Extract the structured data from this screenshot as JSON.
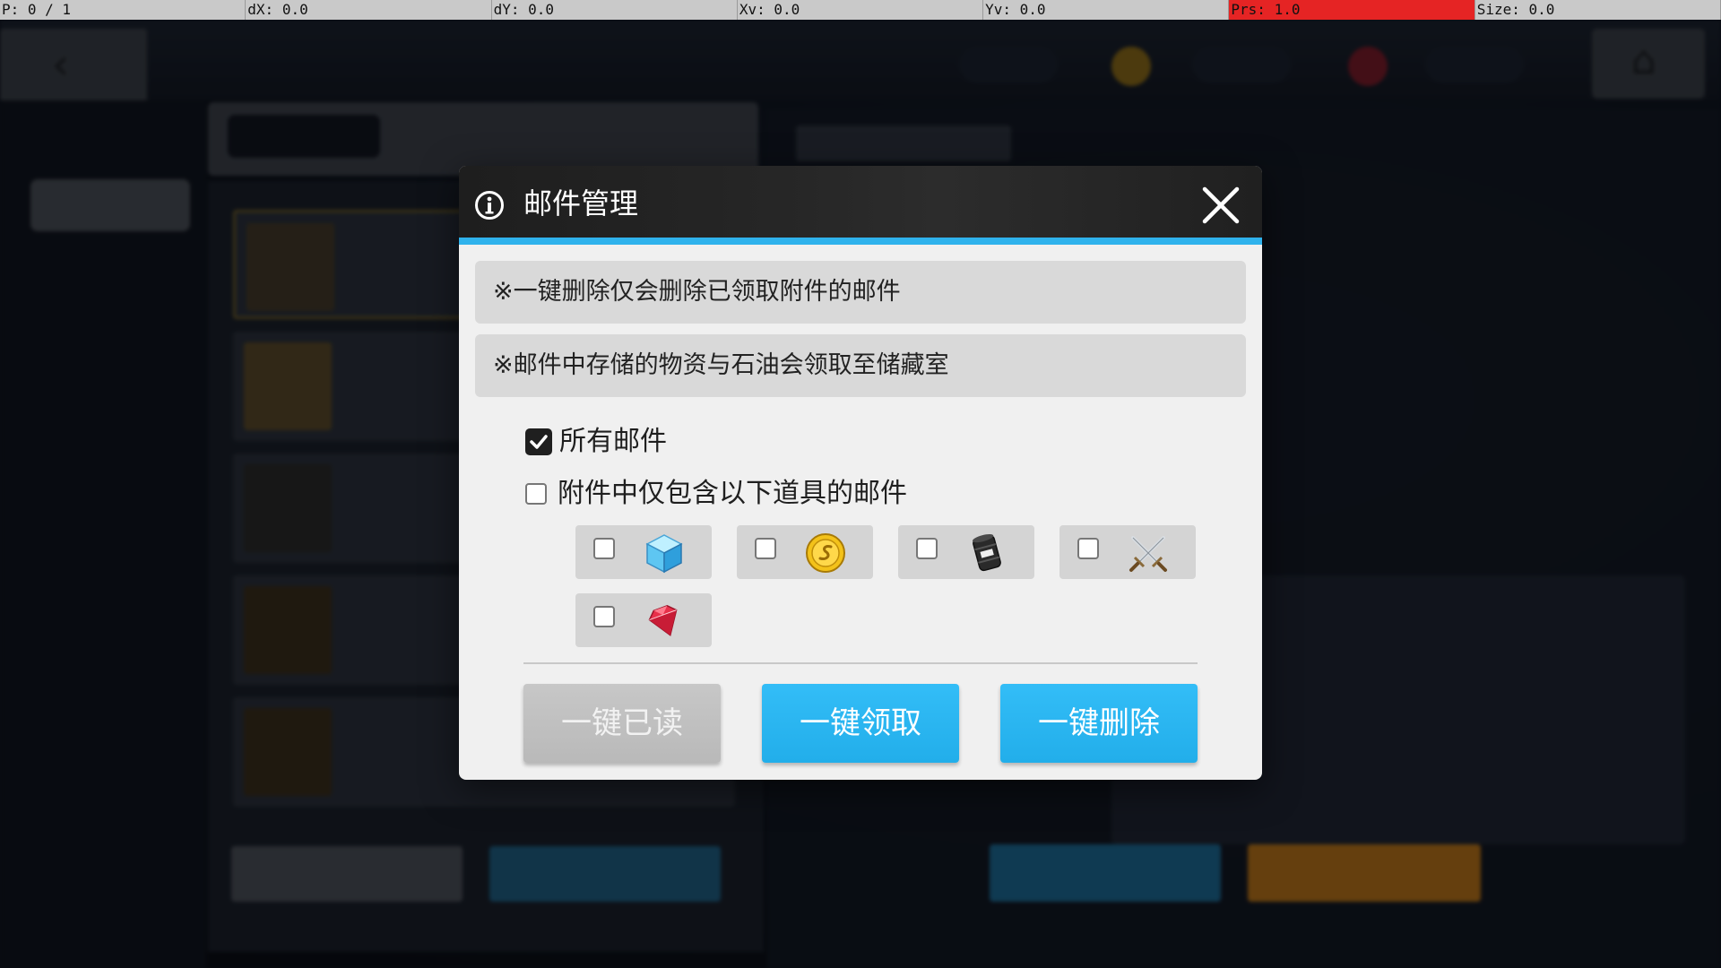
{
  "debug_bar": {
    "pointer": "P: 0 / 1",
    "dx": "dX: 0.0",
    "dy": "dY: 0.0",
    "xv": "Xv: 0.0",
    "yv": "Yv: 0.0",
    "prs": "Prs: 1.0",
    "size": "Size: 0.0"
  },
  "dialog": {
    "title": "邮件管理",
    "notices": [
      "※一键删除仅会删除已领取附件的邮件",
      "※邮件中存储的物资与石油会领取至储藏室"
    ],
    "filters": {
      "all_mail": {
        "label": "所有邮件",
        "checked": true
      },
      "attachment_only": {
        "label": "附件中仅包含以下道具的邮件",
        "checked": false
      }
    },
    "items": [
      {
        "icon": "cube-icon",
        "checked": false
      },
      {
        "icon": "gold-coin-icon",
        "checked": false
      },
      {
        "icon": "oil-barrel-icon",
        "checked": false
      },
      {
        "icon": "crossed-swords-icon",
        "checked": false
      },
      {
        "icon": "red-gem-icon",
        "checked": false
      }
    ],
    "buttons": {
      "read_all": "一键已读",
      "claim_all": "一键领取",
      "delete_all": "一键删除"
    }
  },
  "colors": {
    "header_bg": "#232323",
    "accent_line": "#2fb2ec",
    "primary_button": "#29b5f0",
    "disabled_button": "#c1c1c1",
    "dialog_bg": "#f0f0f0",
    "notice_bg": "#d9d9d9"
  }
}
